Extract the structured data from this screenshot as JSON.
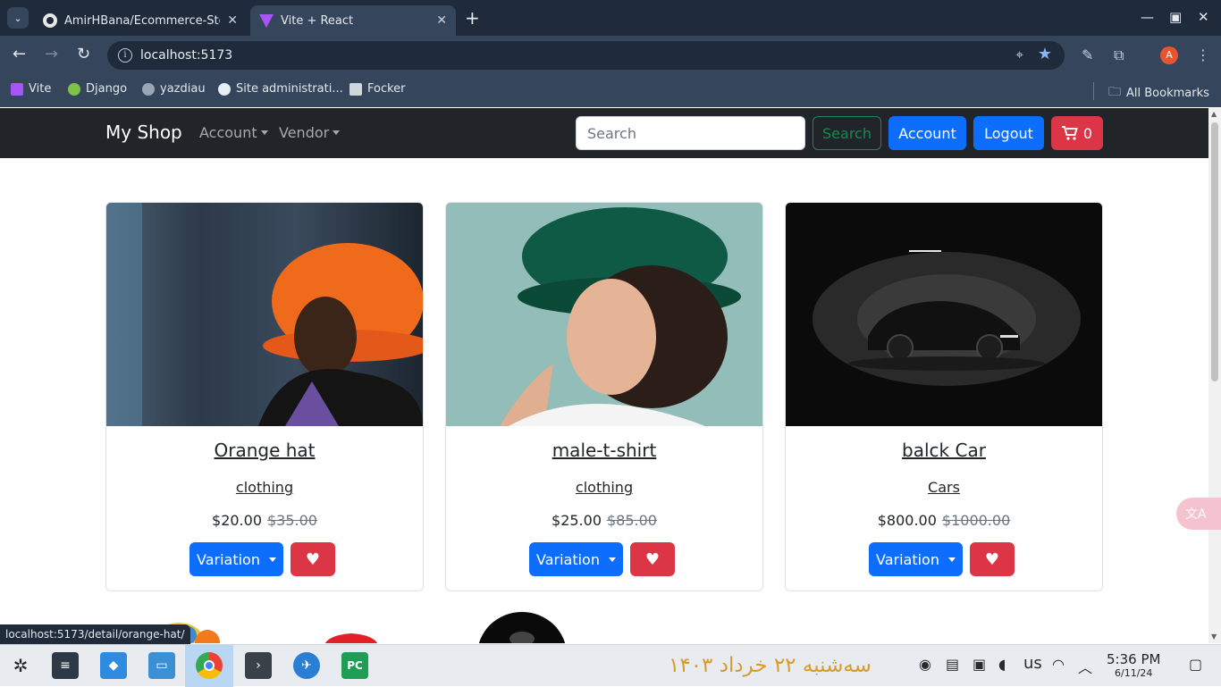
{
  "browser": {
    "tabs": [
      {
        "title": "AmirHBana/Ecommerce-Sto",
        "active": false
      },
      {
        "title": "Vite + React",
        "active": true
      }
    ],
    "url": "localhost:5173",
    "bookmarks": [
      "Vite",
      "Django",
      "yazdiau",
      "Site administrati...",
      "Focker"
    ],
    "all_bookmarks": "All Bookmarks",
    "profile_initial": "A",
    "status_url": "localhost:5173/detail/orange-hat/"
  },
  "navbar": {
    "brand": "My Shop",
    "menus": [
      "Account",
      "Vendor"
    ],
    "search_placeholder": "Search",
    "search_button": "Search",
    "account_button": "Account",
    "logout_button": "Logout",
    "cart_count": "0"
  },
  "products": [
    {
      "title": "Orange hat",
      "category": "clothing",
      "price": "$20.00",
      "old_price": "$35.00",
      "variation_label": "Variation"
    },
    {
      "title": "male-t-shirt",
      "category": "clothing",
      "price": "$25.00",
      "old_price": "$85.00",
      "variation_label": "Variation"
    },
    {
      "title": "balck Car",
      "category": "Cars",
      "price": "$800.00",
      "old_price": "$1000.00",
      "variation_label": "Variation"
    }
  ],
  "taskbar": {
    "persian_date": "سه‌شنبه ۲۲ خرداد ۱۴۰۳",
    "keyboard_layout": "us",
    "time": "5:36 PM",
    "date": "6/11/24"
  },
  "colors": {
    "primary": "#0d6efd",
    "danger": "#dc3545",
    "success": "#198754",
    "navbar_bg": "#212529"
  }
}
